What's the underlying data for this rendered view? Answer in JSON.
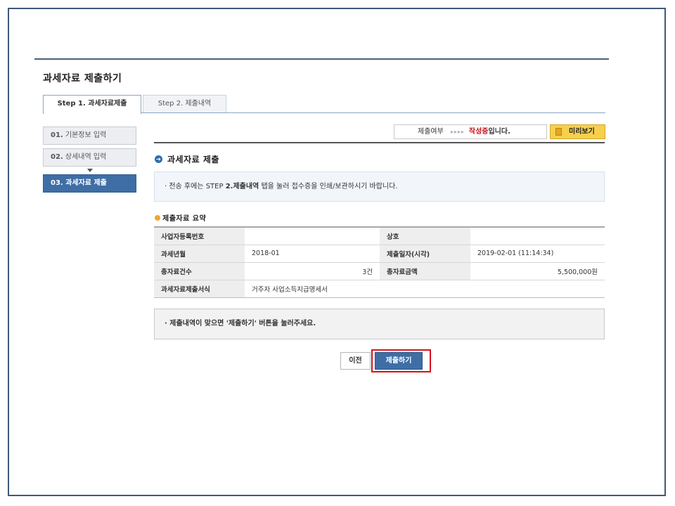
{
  "page": {
    "title": "과세자료 제출하기"
  },
  "tabs": [
    {
      "label": "Step 1. 과세자료제출",
      "active": true
    },
    {
      "label": "Step 2. 제출내역",
      "active": false
    }
  ],
  "sidebar": {
    "items": [
      {
        "num": "01.",
        "label": "기본정보 입력",
        "state": "done"
      },
      {
        "num": "02.",
        "label": "상세내역 입력",
        "state": "done"
      },
      {
        "num": "03.",
        "label": "과세자료 제출",
        "state": "current"
      }
    ]
  },
  "status": {
    "label": "제출여부",
    "arrows": "▸▸▸▸",
    "value_red": "작성중",
    "value_suffix": "입니다."
  },
  "preview_button": {
    "label": "미리보기"
  },
  "section": {
    "title": "과세자료 제출"
  },
  "notice": {
    "prefix": "· 전송 후에는 STEP ",
    "bold": "2.제출내역",
    "suffix": " 탭을 눌러 접수증을 인쇄/보관하시기 바랍니다."
  },
  "summary": {
    "title": "제출자료 요약",
    "rows": [
      {
        "label1": "사업자등록번호",
        "value1": "",
        "label2": "상호",
        "value2": ""
      },
      {
        "label1": "과세년월",
        "value1": "2018-01",
        "label2": "제출일자(시각)",
        "value2": "2019-02-01 (11:14:34)"
      },
      {
        "label1": "총자료건수",
        "value1": "3건",
        "label2": "총자료금액",
        "value2": "5,500,000원"
      },
      {
        "label1": "과세자료제출서식",
        "value1": "거주자 사업소득지급명세서"
      }
    ]
  },
  "confirm": {
    "text": "· 제출내역이 맞으면 '제출하기' 버튼을 눌러주세요."
  },
  "buttons": {
    "prev": "이전",
    "submit": "제출하기"
  },
  "colors": {
    "accent": "#3e6ea5",
    "highlight": "#d6111c",
    "status_red": "#c0141b",
    "preview_bg": "#f6d04d"
  }
}
